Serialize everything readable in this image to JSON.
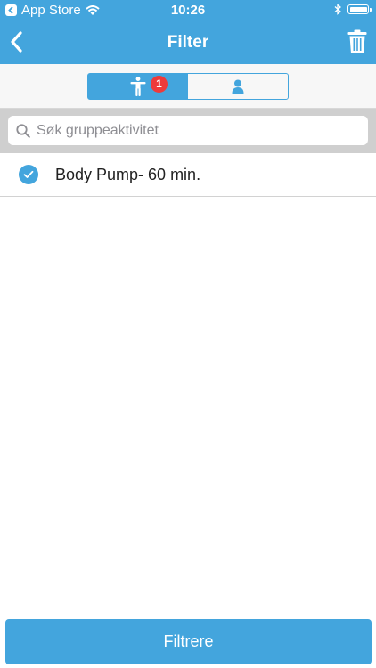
{
  "status_bar": {
    "back_app_label": "App Store",
    "time": "10:26"
  },
  "nav": {
    "title": "Filter",
    "back_icon": "chevron-left-icon",
    "trash_icon": "trash-icon"
  },
  "tabs": [
    {
      "icon": "person-activity-icon",
      "badge": "1",
      "active": true
    },
    {
      "icon": "person-icon",
      "active": false
    }
  ],
  "search": {
    "placeholder": "Søk gruppeaktivitet",
    "value": ""
  },
  "items": [
    {
      "label": "Body Pump- 60 min.",
      "checked": true
    }
  ],
  "footer": {
    "button_label": "Filtrere"
  },
  "colors": {
    "accent": "#43a5dd",
    "badge": "#ee3a3a"
  }
}
